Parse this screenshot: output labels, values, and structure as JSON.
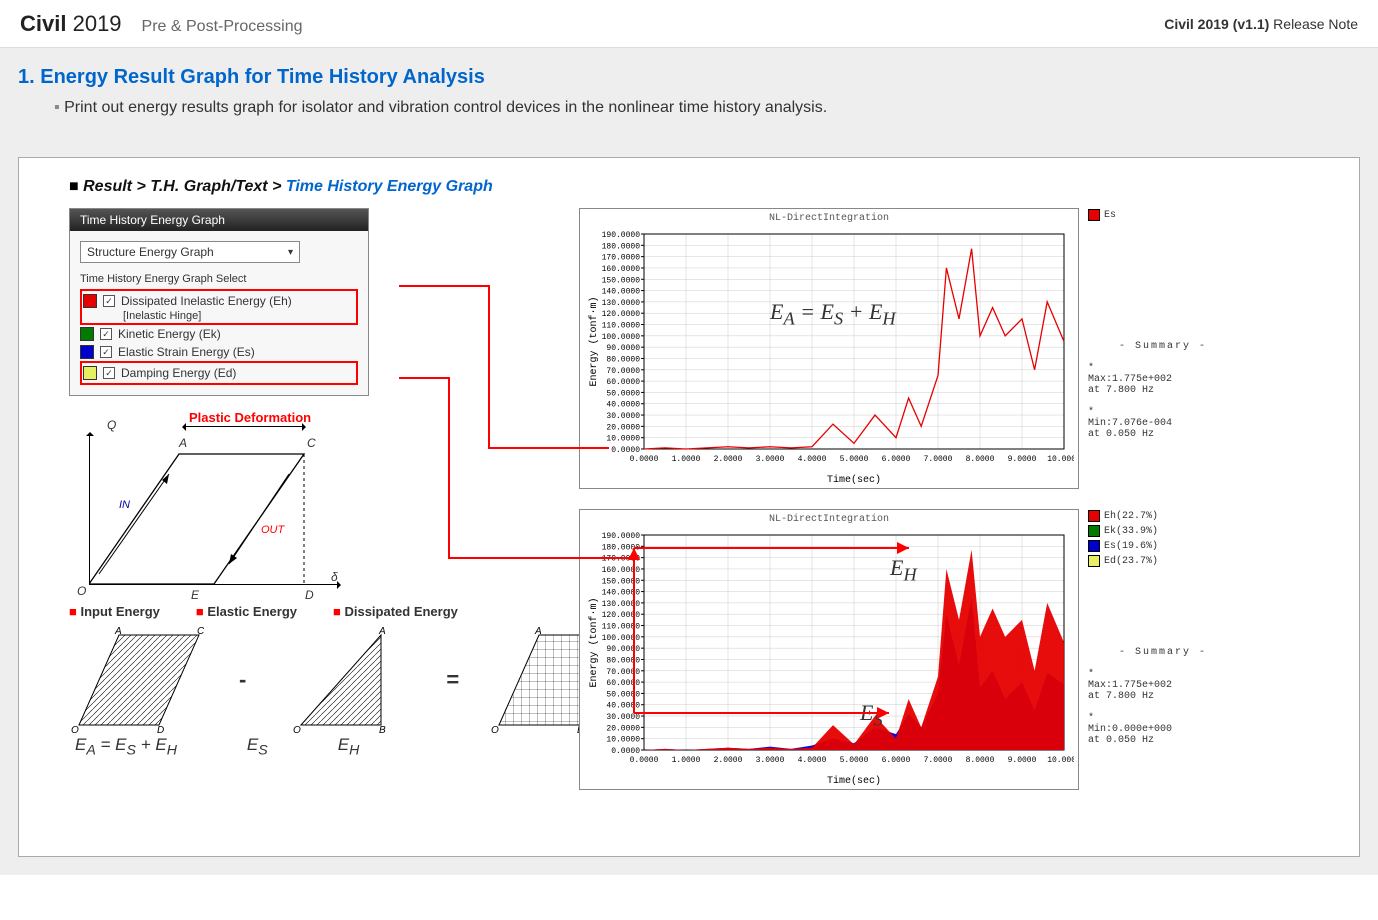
{
  "header": {
    "brand_bold": "Civil",
    "brand_year": "2019",
    "subtitle": "Pre & Post-Processing",
    "release_prefix": "Civil 2019 (v1.1)",
    "release_suffix": " Release Note"
  },
  "section": {
    "number": "1.",
    "title": "Energy Result Graph for Time History Analysis",
    "description": "Print out  energy results graph for isolator and vibration control devices in the nonlinear time history analysis."
  },
  "breadcrumb": {
    "a": "Result",
    "b": "T.H. Graph/Text",
    "c": "Time History Energy Graph"
  },
  "dialog": {
    "tab": "Time History Energy Graph",
    "dropdown": "Structure Energy Graph",
    "group": "Time History Energy Graph Select",
    "items": [
      {
        "color": "#e60000",
        "label": "Dissipated Inelastic Energy (Eh)",
        "sub": "[Inelastic Hinge]",
        "hl": true
      },
      {
        "color": "#007a00",
        "label": "Kinetic Energy (Ek)",
        "hl": false
      },
      {
        "color": "#0000cc",
        "label": "Elastic Strain Energy (Es)",
        "hl": false
      },
      {
        "color": "#e6f060",
        "label": "Damping Energy (Ed)",
        "hl": true
      }
    ]
  },
  "hysteresis": {
    "title": "Plastic Deformation",
    "Q": "Q",
    "A": "A",
    "C": "C",
    "O": "O",
    "E": "E",
    "D": "D",
    "IN": "IN",
    "OUT": "OUT",
    "delta": "δ"
  },
  "energy_shapes": {
    "h1": "Input Energy",
    "h2": "Elastic Energy",
    "h3": "Dissipated Energy",
    "eq": "E_A = E_S + E_H",
    "es": "E_S",
    "eh": "E_H",
    "A": "A",
    "B": "B",
    "C": "C",
    "D": "D",
    "E": "E",
    "O": "O"
  },
  "charts": {
    "title": "NL-DirectIntegration",
    "xlabel": "Time(sec)",
    "ylabel": "Energy (tonf·m)",
    "summary_title": "- Summary -",
    "legend_line": "Es",
    "legend_stack": [
      {
        "label": "Eh(22.7%)",
        "color": "#e60000"
      },
      {
        "label": "Ek(33.9%)",
        "color": "#007a00"
      },
      {
        "label": "Es(19.6%)",
        "color": "#0000cc"
      },
      {
        "label": "Ed(23.7%)",
        "color": "#e6f060"
      }
    ],
    "summary_top": {
      "max": "Max:1.775e+002",
      "max_at": "at   7.800 Hz",
      "min": "Min:7.076e-004",
      "min_at": "at   0.050 Hz"
    },
    "summary_bot": {
      "max": "Max:1.775e+002",
      "max_at": "at   7.800 Hz",
      "min": "Min:0.000e+000",
      "min_at": "at   0.050 Hz"
    },
    "formula_top": "E_A = E_S + E_H",
    "label_EH": "E_H",
    "label_ES": "E_S"
  },
  "chart_data": [
    {
      "type": "line",
      "title": "NL-DirectIntegration",
      "xlabel": "Time(sec)",
      "ylabel": "Energy (tonf·m)",
      "xlim": [
        0,
        10
      ],
      "ylim": [
        0,
        190
      ],
      "x": [
        0,
        0.5,
        1,
        1.5,
        2,
        2.5,
        3,
        3.5,
        4,
        4.5,
        5,
        5.5,
        6,
        6.3,
        6.6,
        7,
        7.2,
        7.5,
        7.8,
        8,
        8.3,
        8.6,
        9,
        9.3,
        9.6,
        10
      ],
      "series": [
        {
          "name": "Es",
          "color": "#e60000",
          "values": [
            0,
            1,
            0,
            1,
            2,
            1,
            2,
            1,
            2,
            22,
            5,
            30,
            10,
            45,
            20,
            65,
            160,
            115,
            177,
            100,
            125,
            100,
            115,
            70,
            130,
            95
          ]
        }
      ]
    },
    {
      "type": "area",
      "title": "NL-DirectIntegration",
      "xlabel": "Time(sec)",
      "ylabel": "Energy (tonf·m)",
      "xlim": [
        0,
        10
      ],
      "ylim": [
        0,
        190
      ],
      "x": [
        0,
        0.5,
        1,
        1.5,
        2,
        2.5,
        3,
        3.5,
        4,
        4.5,
        5,
        5.5,
        6,
        6.3,
        6.6,
        7,
        7.2,
        7.5,
        7.8,
        8,
        8.3,
        8.6,
        9,
        9.3,
        9.6,
        10
      ],
      "series": [
        {
          "name": "Es",
          "color": "#0000cc",
          "values": [
            0,
            1,
            0,
            1,
            2,
            1,
            3,
            1,
            4,
            10,
            6,
            20,
            14,
            32,
            20,
            50,
            120,
            75,
            135,
            55,
            70,
            45,
            60,
            35,
            68,
            58
          ]
        },
        {
          "name": "Eh",
          "color": "#e60000",
          "values": [
            0,
            1,
            0,
            1,
            2,
            1,
            2,
            1,
            2,
            22,
            5,
            30,
            10,
            45,
            20,
            65,
            160,
            115,
            177,
            100,
            125,
            100,
            115,
            70,
            130,
            95
          ]
        }
      ]
    }
  ]
}
